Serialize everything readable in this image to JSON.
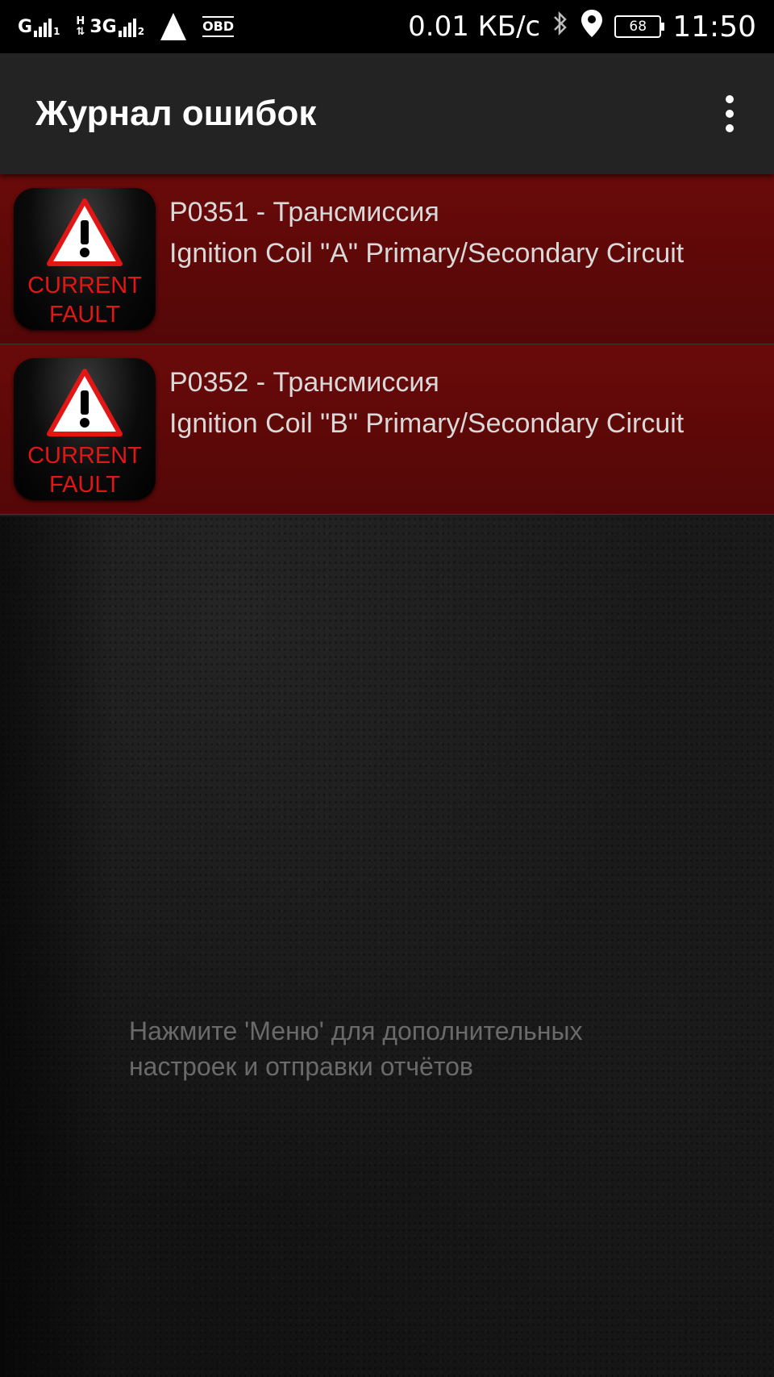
{
  "status_bar": {
    "sim1_label": "G",
    "sim1_index": "1",
    "sim2_type_top": "H",
    "sim2_label": "3G",
    "sim2_index": "2",
    "obd_label": "OBD",
    "net_speed": "0.01 КБ/с",
    "battery_level": "68",
    "time": "11:50"
  },
  "app_bar": {
    "title": "Журнал ошибок",
    "menu_icon": "overflow-menu-icon"
  },
  "faults": [
    {
      "code": "P0351",
      "separator": " - ",
      "system": "Трансмиссия",
      "description": "Ignition Coil \"A\" Primary/Secondary Circuit",
      "badge_line1": "CURRENT",
      "badge_line2": "FAULT"
    },
    {
      "code": "P0352",
      "separator": " - ",
      "system": "Трансмиссия",
      "description": "Ignition Coil \"B\" Primary/Secondary Circuit",
      "badge_line1": "CURRENT",
      "badge_line2": "FAULT"
    }
  ],
  "hint": {
    "line1": "Нажмите 'Меню' для дополнительных",
    "line2": "настроек и отправки отчётов"
  },
  "colors": {
    "fault_row_bg": "#5e0909",
    "badge_red": "#e31616",
    "app_bar_bg": "#232323",
    "status_bar_bg": "#000000"
  }
}
